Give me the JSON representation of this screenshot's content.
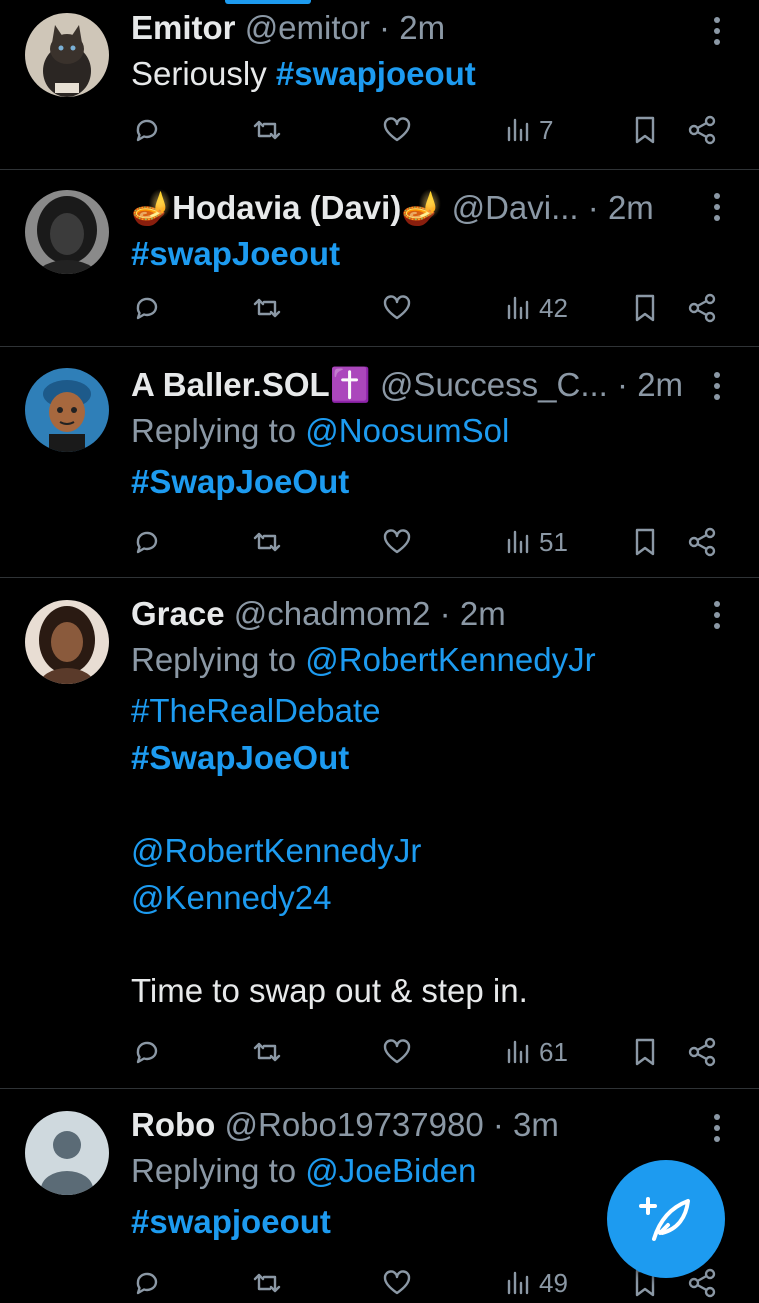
{
  "accent_color": "#1d9bf0",
  "tweets": [
    {
      "name": "Emitor",
      "handle": "@emitor",
      "separator": "·",
      "time": "2m",
      "avatar_icon": "cat-avatar",
      "reply_prefix": "",
      "reply_to": "",
      "body": [
        {
          "plain": "Seriously ",
          "tag": "#swapjoeout"
        }
      ],
      "views": "7"
    },
    {
      "name": "🪔Hodavia (Davi)🪔",
      "handle": "@Davi...",
      "separator": "·",
      "time": "2m",
      "avatar_icon": "person-avatar",
      "reply_prefix": "",
      "reply_to": "",
      "body": [
        {
          "plain": "",
          "tag": "#swapJoeout"
        }
      ],
      "views": "42"
    },
    {
      "name": "A Baller.SOL✝️",
      "handle": "@Success_C...",
      "separator": "·",
      "time": "2m",
      "avatar_icon": "cartoon-avatar",
      "reply_prefix": "Replying to ",
      "reply_to": "@NoosumSol",
      "body": [
        {
          "plain": "",
          "tag": "#SwapJoeOut"
        }
      ],
      "views": "51"
    },
    {
      "name": "Grace",
      "handle": "@chadmom2",
      "separator": "·",
      "time": "2m",
      "avatar_icon": "person-avatar",
      "reply_prefix": "Replying to ",
      "reply_to": "@RobertKennedyJr",
      "body_lines": [
        "#TheRealDebate",
        "#SwapJoeOut",
        "",
        "@RobertKennedyJr",
        "@Kennedy24",
        "",
        "Time to swap out & step in."
      ],
      "views": "61"
    },
    {
      "name": "Robo",
      "handle": "@Robo19737980",
      "separator": "·",
      "time": "3m",
      "avatar_icon": "default-avatar",
      "reply_prefix": "Replying to ",
      "reply_to": "@JoeBiden",
      "body": [
        {
          "plain": "",
          "tag": "#swapjoeout"
        }
      ],
      "views": "49"
    }
  ],
  "icons": {
    "reply": "reply-icon",
    "retweet": "retweet-icon",
    "like": "like-icon",
    "views": "views-icon",
    "bookmark": "bookmark-icon",
    "share": "share-icon",
    "more": "more-icon",
    "compose": "compose-icon"
  }
}
